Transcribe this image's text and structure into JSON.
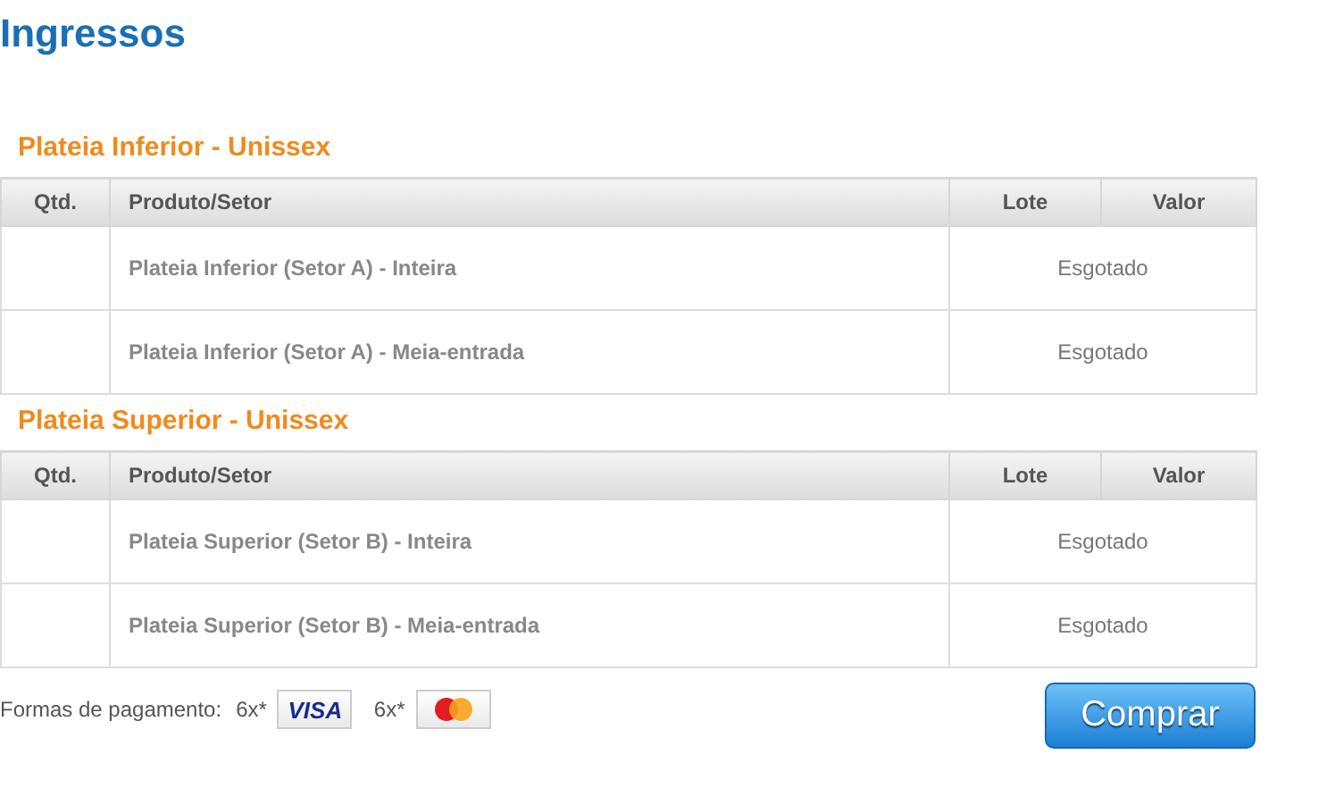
{
  "title": "Ingressos",
  "sections": [
    {
      "heading": "Plateia Inferior - Unissex",
      "columns": [
        "Qtd.",
        "Produto/Setor",
        "Lote",
        "Valor"
      ],
      "rows": [
        {
          "product": "Plateia Inferior (Setor A) - Inteira",
          "status": "Esgotado"
        },
        {
          "product": "Plateia Inferior (Setor A) - Meia-entrada",
          "status": "Esgotado"
        }
      ]
    },
    {
      "heading": "Plateia Superior - Unissex",
      "columns": [
        "Qtd.",
        "Produto/Setor",
        "Lote",
        "Valor"
      ],
      "rows": [
        {
          "product": "Plateia Superior (Setor B) - Inteira",
          "status": "Esgotado"
        },
        {
          "product": "Plateia Superior (Setor B) - Meia-entrada",
          "status": "Esgotado"
        }
      ]
    }
  ],
  "payment": {
    "label": "Formas de pagamento:",
    "methods": [
      {
        "kind": "visa",
        "installments": "6x*",
        "logo_text": "VISA"
      },
      {
        "kind": "mastercard",
        "installments": "6x*"
      }
    ]
  },
  "buy_button": "Comprar"
}
